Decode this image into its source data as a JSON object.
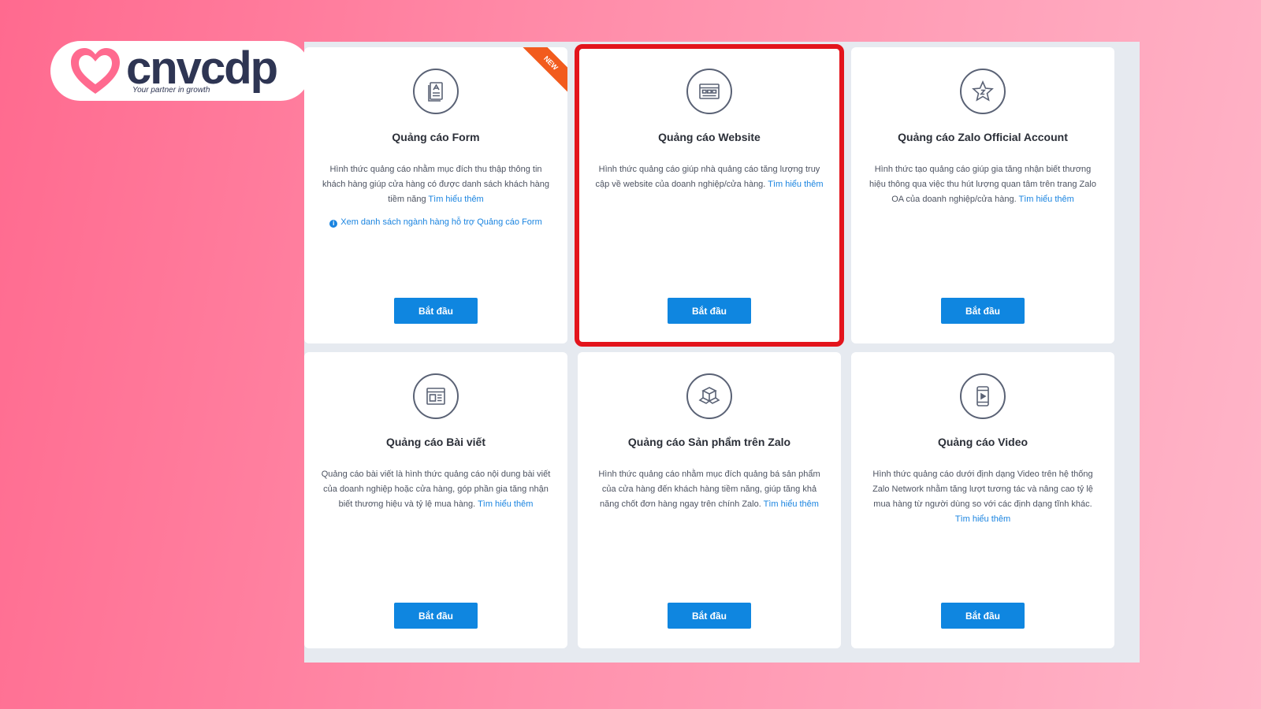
{
  "brand": {
    "name": "cnvcdp",
    "tagline": "Your partner in growth",
    "colors": {
      "heart": "#ff6a8f",
      "text": "#2e3553"
    }
  },
  "cards": [
    {
      "title": "Quảng cáo Form",
      "icon": "form-icon",
      "badge": "NEW",
      "description": "Hình thức quảng cáo nhằm mục đích thu thập thông tin khách hàng giúp cửa hàng có được danh sách khách hàng tiềm năng",
      "link": "Tìm hiểu thêm",
      "note": "Xem danh sách ngành hàng hỗ trợ Quảng cáo Form",
      "button": "Bắt đầu"
    },
    {
      "title": "Quảng cáo Website",
      "icon": "website-icon",
      "description": "Hình thức quảng cáo giúp nhà quảng cáo tăng lượng truy cập về website của doanh nghiệp/cửa hàng.",
      "link": "Tìm hiểu thêm",
      "button": "Bắt đầu"
    },
    {
      "title": "Quảng cáo Zalo Official Account",
      "icon": "star-icon",
      "description": "Hình thức tạo quảng cáo giúp gia tăng nhận biết thương hiệu thông qua việc thu hút lượng quan tâm trên trang Zalo OA của doanh nghiệp/cửa hàng.",
      "link": "Tìm hiểu thêm",
      "button": "Bắt đầu"
    },
    {
      "title": "Quảng cáo Bài viết",
      "icon": "article-icon",
      "description": "Quảng cáo bài viết là hình thức quảng cáo nội dung bài viết của doanh nghiệp hoặc cửa hàng, góp phần gia tăng nhận biết thương hiệu và tỷ lệ mua hàng.",
      "link": "Tìm hiểu thêm",
      "button": "Bắt đầu"
    },
    {
      "title": "Quảng cáo Sản phẩm trên Zalo",
      "icon": "product-box-icon",
      "description": "Hình thức quảng cáo nhằm mục đích quảng bá sản phẩm của cửa hàng đến khách hàng tiềm năng, giúp tăng khả năng chốt đơn hàng ngay trên chính Zalo.",
      "link": "Tìm hiểu thêm",
      "button": "Bắt đầu"
    },
    {
      "title": "Quảng cáo Video",
      "icon": "video-icon",
      "description": "Hình thức quảng cáo dưới định dạng Video trên hệ thống Zalo Network nhằm tăng lượt tương tác và nâng cao tỷ lệ mua hàng từ người dùng so với các định dạng tĩnh khác.",
      "link": "Tìm hiểu thêm",
      "button": "Bắt đầu"
    }
  ],
  "highlight_color": "#e3141c",
  "accent_color": "#0f86e0"
}
